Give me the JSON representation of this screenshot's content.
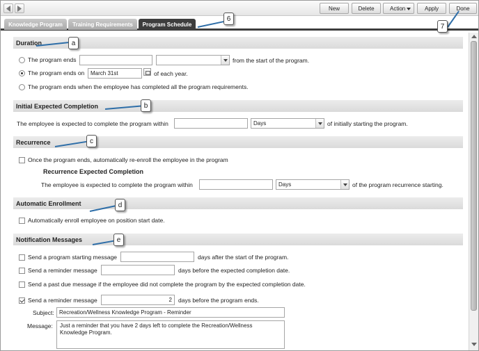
{
  "toolbar": {
    "buttons": [
      {
        "label": "New"
      },
      {
        "label": "Delete"
      },
      {
        "label": "Action"
      },
      {
        "label": "Apply"
      },
      {
        "label": "Done"
      }
    ]
  },
  "tabs": [
    {
      "label": "Knowledge Program",
      "active": false
    },
    {
      "label": "Training Requirements",
      "active": false
    },
    {
      "label": "Program Schedule",
      "active": true
    }
  ],
  "callouts": {
    "six": "6",
    "seven": "7",
    "a": "a",
    "b": "b",
    "c": "c",
    "d": "d",
    "e": "e"
  },
  "duration": {
    "title": "Duration",
    "option1": {
      "label": "The program ends",
      "amount": "",
      "unit": "",
      "suffix": "from the start of the program.",
      "selected": false
    },
    "option2": {
      "label": "The program ends on",
      "date": "March 31st",
      "suffix": "of each year.",
      "selected": true
    },
    "option3": {
      "label": "The program ends when the employee has completed all the program requirements.",
      "selected": false
    }
  },
  "initial_completion": {
    "title": "Initial Expected Completion",
    "prefix": "The employee is expected to complete the program within",
    "amount": "",
    "unit": "Days",
    "suffix": "of initially starting the program."
  },
  "recurrence": {
    "title": "Recurrence",
    "checkbox_label": "Once the program ends, automatically re-enroll the employee in the program",
    "checked": false,
    "subheading": "Recurrence Expected Completion",
    "prefix": "The employee is expected to complete the program within",
    "amount": "",
    "unit": "Days",
    "suffix": "of the program recurrence starting."
  },
  "auto_enrollment": {
    "title": "Automatic Enrollment",
    "checkbox_label": "Automatically enroll employee on position start date.",
    "checked": false
  },
  "notifications": {
    "title": "Notification Messages",
    "start_msg": {
      "label": "Send a program starting message",
      "value": "",
      "suffix": "days after the start of the program.",
      "checked": false
    },
    "reminder1": {
      "label": "Send a reminder message",
      "value": "",
      "suffix": "days before the expected completion date.",
      "checked": false
    },
    "past_due": {
      "label": "Send a past due message if the employee did not complete the program by the expected completion date.",
      "checked": false
    },
    "reminder2": {
      "label": "Send a reminder message",
      "value": "2",
      "suffix": "days before the program ends.",
      "checked": true
    },
    "subject_label": "Subject:",
    "subject_value": "Recreation/Wellness Knowledge Program - Reminder",
    "message_label": "Message:",
    "message_value": "Just a reminder that you have 2 days left to complete the Recreation/Wellness Knowledge Program."
  },
  "colors": {
    "callout_line": "#2e6ea8",
    "active_tab": "#3d3d3d",
    "section_header": "#e0e0e0"
  }
}
